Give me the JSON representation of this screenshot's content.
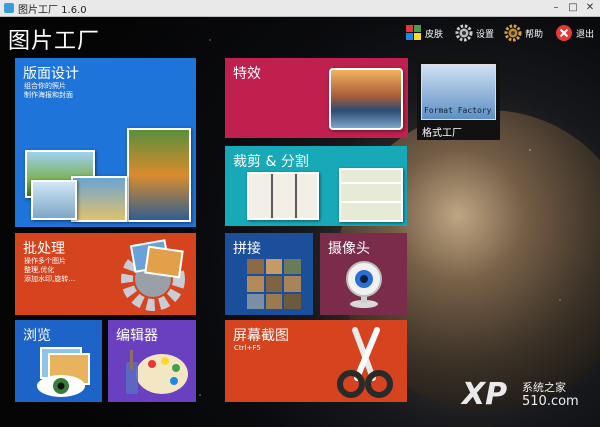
{
  "window": {
    "title": "图片工厂 1.6.0",
    "minimize": "–",
    "maximize": "□",
    "close": "✕"
  },
  "app_title": "图片工厂",
  "toolbar": [
    {
      "id": "skin",
      "label": "皮肤",
      "icon": "palette-icon"
    },
    {
      "id": "settings",
      "label": "设置",
      "icon": "gear-icon"
    },
    {
      "id": "help",
      "label": "帮助",
      "icon": "help-gear-icon"
    },
    {
      "id": "exit",
      "label": "退出",
      "icon": "exit-icon"
    }
  ],
  "tiles": {
    "layout": {
      "name": "版面设计",
      "desc1": "组合你的照片",
      "desc2": "制作海报和封面",
      "color": "#1e74d8"
    },
    "effects": {
      "name": "特效",
      "color": "#c0204e"
    },
    "format_factory": {
      "badge": "Format Factory",
      "name": "格式工厂",
      "color": "#111111"
    },
    "crop": {
      "name": "裁剪 & 分割",
      "color": "#18a9b8"
    },
    "batch": {
      "name": "批处理",
      "desc1": "操作多个图片",
      "desc2": "整理,优化",
      "desc3": "添加水印,旋转…",
      "color": "#d5431f"
    },
    "stitch": {
      "name": "拼接",
      "color": "#1b4f9c"
    },
    "camera": {
      "name": "摄像头",
      "color": "#7b2c4a"
    },
    "browse": {
      "name": "浏览",
      "color": "#1e63c8"
    },
    "editor": {
      "name": "编辑器",
      "color": "#6a3fc0"
    },
    "screenshot": {
      "name": "屏幕截图",
      "desc1": "Ctrl+F5",
      "color": "#d5431f"
    }
  },
  "watermark": {
    "logo": "XP",
    "line1": "系统之家",
    "line2": "510.com"
  }
}
